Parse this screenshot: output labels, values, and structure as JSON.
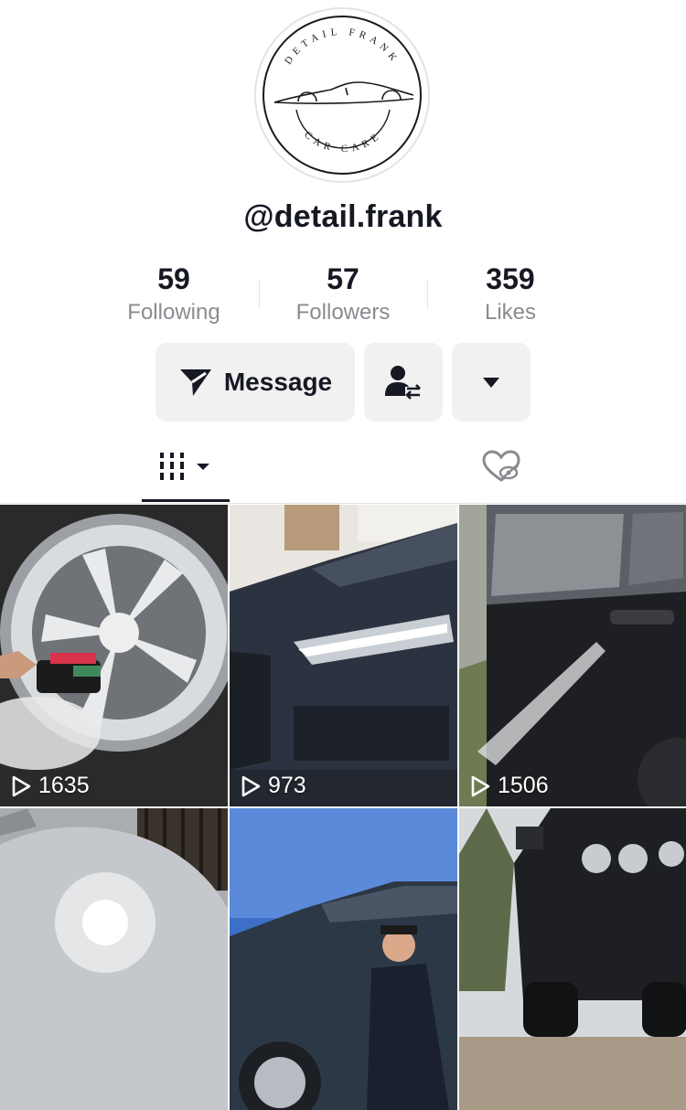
{
  "profile": {
    "logo": {
      "top_text": "DETAIL  FRANK",
      "bottom_text": "CAR   CARE",
      "icon": "car-silhouette-logo"
    },
    "username": "@detail.frank"
  },
  "stats": [
    {
      "value": "59",
      "label": "Following"
    },
    {
      "value": "57",
      "label": "Followers"
    },
    {
      "value": "359",
      "label": "Likes"
    }
  ],
  "actions": {
    "message_label": "Message",
    "message_icon": "send-icon",
    "follow_icon": "user-swap-icon",
    "more_icon": "caret-down-icon"
  },
  "tabs": [
    {
      "icon": "grid-columns-icon",
      "active": true
    },
    {
      "icon": "hidden-heart-icon",
      "active": false
    }
  ],
  "videos": [
    {
      "views": "1635",
      "subject": "foamed wheel being brushed"
    },
    {
      "views": "973",
      "subject": "wet dark Audi front"
    },
    {
      "views": "1506",
      "subject": "pressure washing dark car side"
    },
    {
      "views": "",
      "subject": "sunlight glare on car panel"
    },
    {
      "views": "",
      "subject": "man crouching by dark car"
    },
    {
      "views": "",
      "subject": "car rear in driveway"
    }
  ],
  "colors": {
    "text": "#161823",
    "secondary": "#8a8b91",
    "button_bg": "#f1f1f2",
    "divider": "#e3e3e4"
  }
}
